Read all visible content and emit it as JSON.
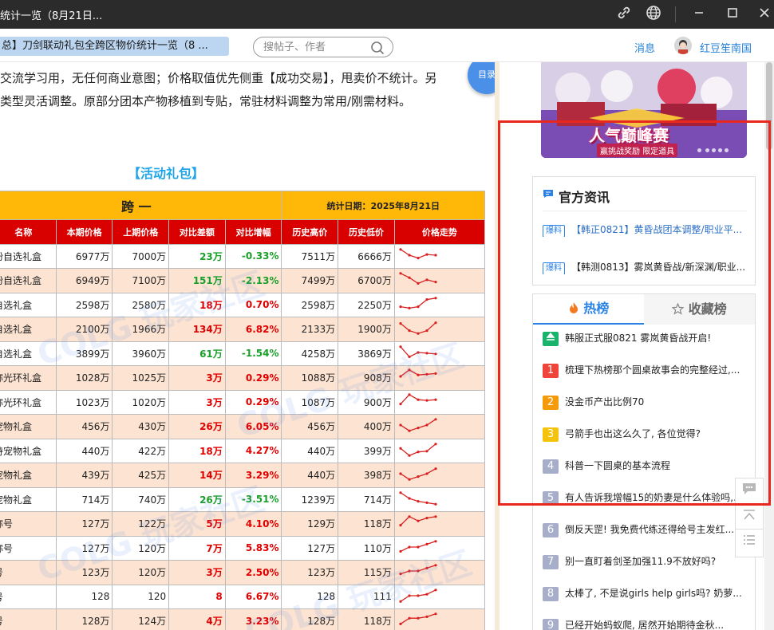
{
  "window": {
    "title": "统计一览（8月21日..."
  },
  "nav": {
    "tab_title": "总】刀剑联动礼包全跨区物价统计一览（8 ...",
    "search_placeholder": "搜帖子、作者",
    "messages": "消息",
    "username": "红豆笙南国"
  },
  "content": {
    "intro_line1": "交流学习用，无任何商业意图；价格取值优先侧重【成功交易】，甩卖价不统计。另",
    "intro_line2": "类型灵活调整。原部分团本产物移植到专贴，常驻材料调整为常用/刚需材料。",
    "toc_label": "目录",
    "section_title": "【活动礼包】",
    "watermark": "COLG 玩家社区",
    "table": {
      "region": "跨 一",
      "stat_date": "统计日期：2025年8月21日",
      "headers": [
        "名称",
        "本期价格",
        "上期价格",
        "对比差额",
        "对比增幅",
        "历史高价",
        "历史低价",
        "价格走势"
      ],
      "rows": [
        {
          "name": "纷自选礼盒",
          "cur": "6977万",
          "prev": "7000万",
          "diff": "23万",
          "pct": "-0.33%",
          "up": false,
          "high": "7511万",
          "low": "6666万",
          "trend": [
            0.9,
            0.5,
            0.3,
            0.55,
            0.5
          ]
        },
        {
          "name": "纷自选礼盒",
          "cur": "6949万",
          "prev": "7100万",
          "diff": "151万",
          "pct": "-2.13%",
          "up": false,
          "high": "7499万",
          "low": "6700万",
          "trend": [
            0.9,
            0.6,
            0.2,
            0.45,
            0.3
          ]
        },
        {
          "name": "自选礼盒",
          "cur": "2598万",
          "prev": "2580万",
          "diff": "18万",
          "pct": "0.70%",
          "up": true,
          "high": "2598万",
          "low": "2250万",
          "trend": [
            0.3,
            0.2,
            0.3,
            0.8,
            0.9
          ]
        },
        {
          "name": "自选礼盒",
          "cur": "2100万",
          "prev": "1966万",
          "diff": "134万",
          "pct": "6.82%",
          "up": true,
          "high": "2133万",
          "low": "1900万",
          "trend": [
            0.8,
            0.3,
            0.1,
            0.3,
            0.85
          ]
        },
        {
          "name": "自选礼盒",
          "cur": "3899万",
          "prev": "3960万",
          "diff": "61万",
          "pct": "-1.54%",
          "up": false,
          "high": "4258万",
          "low": "3869万",
          "trend": [
            0.9,
            0.2,
            0.5,
            0.45,
            0.4
          ]
        },
        {
          "name": "称光环礼盒",
          "cur": "1028万",
          "prev": "1025万",
          "diff": "3万",
          "pct": "0.29%",
          "up": true,
          "high": "1088万",
          "low": "908万",
          "trend": [
            0.5,
            0.95,
            0.6,
            0.65,
            0.7
          ]
        },
        {
          "name": "称光环礼盒",
          "cur": "1023万",
          "prev": "1020万",
          "diff": "3万",
          "pct": "0.29%",
          "up": true,
          "high": "1087万",
          "low": "900万",
          "trend": [
            0.3,
            0.95,
            0.6,
            0.55,
            0.6
          ]
        },
        {
          "name": "宠物礼盒",
          "cur": "456万",
          "prev": "430万",
          "diff": "26万",
          "pct": "6.05%",
          "up": true,
          "high": "456万",
          "low": "400万",
          "trend": [
            0.5,
            0.1,
            0.3,
            0.5,
            0.9
          ]
        },
        {
          "name": "持宠物礼盒",
          "cur": "440万",
          "prev": "422万",
          "diff": "18万",
          "pct": "4.27%",
          "up": true,
          "high": "440万",
          "low": "399万",
          "trend": [
            0.6,
            0.1,
            0.35,
            0.4,
            0.9
          ]
        },
        {
          "name": "宠物礼盒",
          "cur": "439万",
          "prev": "425万",
          "diff": "14万",
          "pct": "3.29%",
          "up": true,
          "high": "440万",
          "low": "398万",
          "trend": [
            0.5,
            0.1,
            0.3,
            0.5,
            0.85
          ]
        },
        {
          "name": "宠物礼盒",
          "cur": "714万",
          "prev": "740万",
          "diff": "26万",
          "pct": "-3.51%",
          "up": false,
          "high": "1239万",
          "low": "714万",
          "trend": [
            0.9,
            0.5,
            0.3,
            0.2,
            0.1
          ]
        },
        {
          "name": "称号",
          "cur": "127万",
          "prev": "122万",
          "diff": "5万",
          "pct": "4.10%",
          "up": true,
          "high": "129万",
          "low": "118万",
          "trend": [
            0.3,
            0.9,
            0.6,
            0.8,
            0.9
          ]
        },
        {
          "name": "称号",
          "cur": "127万",
          "prev": "120万",
          "diff": "7万",
          "pct": "5.83%",
          "up": true,
          "high": "127万",
          "low": "110万",
          "trend": [
            0.2,
            0.5,
            0.5,
            0.7,
            0.9
          ]
        },
        {
          "name": "号",
          "cur": "123万",
          "prev": "120万",
          "diff": "3万",
          "pct": "2.50%",
          "up": true,
          "high": "123万",
          "low": "115万",
          "trend": [
            0.3,
            0.5,
            0.5,
            0.7,
            0.9
          ]
        },
        {
          "name": "号",
          "cur": "128",
          "prev": "120",
          "diff": "8",
          "pct": "6.67%",
          "up": true,
          "high": "128",
          "low": "111",
          "trend": [
            0.1,
            0.5,
            0.5,
            0.6,
            0.9
          ]
        },
        {
          "name": "号",
          "cur": "128万",
          "prev": "124万",
          "diff": "4万",
          "pct": "3.23%",
          "up": true,
          "high": "128万",
          "low": "118万",
          "trend": [
            0.2,
            0.6,
            0.6,
            0.7,
            0.9
          ]
        }
      ]
    }
  },
  "sidebar": {
    "banner_title": "人气巅峰赛",
    "banner_sub": "赢挑战奖励 限定道具",
    "news_title": "官方资讯",
    "news": [
      {
        "tag": "爆料",
        "text": "【韩正0821】黄昏战团本调整/职业平..."
      },
      {
        "tag": "爆料",
        "text": "【韩测0813】雾岚黄昏战/新深渊/职业..."
      }
    ],
    "tabs": {
      "hot": "热榜",
      "fav": "收藏榜"
    },
    "hot": [
      {
        "rank": "",
        "color": "#19b36b",
        "text": "韩服正式服0821 雾岚黄昏战开启!"
      },
      {
        "rank": "1",
        "color": "#f0443b",
        "text": "梳理下热榜那个圆桌故事会的完整经过,..."
      },
      {
        "rank": "2",
        "color": "#f59a0b",
        "text": "没金币产出比例70"
      },
      {
        "rank": "3",
        "color": "#f5c30b",
        "text": "弓箭手也出这么久了, 各位觉得?"
      },
      {
        "rank": "4",
        "color": "#a7aec9",
        "text": "科普一下圆桌的基本流程"
      },
      {
        "rank": "5",
        "color": "#a7aec9",
        "text": "有人告诉我增幅15的奶妻是什么体验吗,..."
      },
      {
        "rank": "6",
        "color": "#a7aec9",
        "text": "倒反天罡! 我免费代练还得给号主发红..."
      },
      {
        "rank": "7",
        "color": "#a7aec9",
        "text": "别一直盯着剑圣加强11.9不放好吗?"
      },
      {
        "rank": "8",
        "color": "#a7aec9",
        "text": "太棒了, 不是说girls help girls吗? 奶萝..."
      },
      {
        "rank": "9",
        "color": "#a7aec9",
        "text": "已经开始蚂蚁爬, 居然开始期待金秋..."
      }
    ]
  },
  "colors": {
    "accent": "#2b83e6",
    "header_yellow": "#ffb808",
    "header_red": "#d90000",
    "up": "#e00000",
    "down": "#1aa02a",
    "highlight_box": "#e8281e"
  }
}
